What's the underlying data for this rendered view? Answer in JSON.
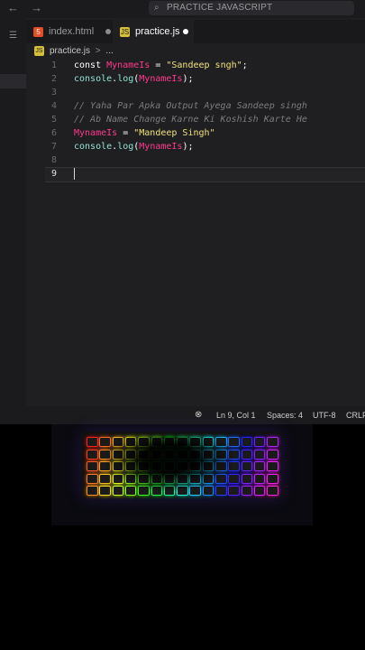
{
  "titlebar": {
    "search_text": "PRACTICE JAVASCRIPT",
    "back_icon": "arrow-left-icon",
    "forward_icon": "arrow-right-icon"
  },
  "tabs": [
    {
      "label": "index.html",
      "icon": "html5-icon",
      "icon_text": "5",
      "icon_color": "#e44d26",
      "modified": true
    },
    {
      "label": "practice.js",
      "icon": "js-icon",
      "icon_text": "JS",
      "icon_color": "#d6c03a",
      "modified": true,
      "active": true
    }
  ],
  "breadcrumb": {
    "file": "practice.js",
    "separator": ">",
    "rest": "..."
  },
  "editor": {
    "lines": [
      {
        "n": "1",
        "tokens": [
          [
            "kw",
            "const "
          ],
          [
            "var",
            "MynameIs"
          ],
          [
            "kw",
            " = "
          ],
          [
            "str",
            "\"Sandeep sngh\""
          ],
          [
            "kw",
            ";"
          ]
        ]
      },
      {
        "n": "2",
        "tokens": [
          [
            "fn",
            "console"
          ],
          [
            "kw",
            "."
          ],
          [
            "fn",
            "log"
          ],
          [
            "kw",
            "("
          ],
          [
            "var",
            "MynameIs"
          ],
          [
            "kw",
            ");"
          ]
        ]
      },
      {
        "n": "3",
        "tokens": []
      },
      {
        "n": "4",
        "tokens": [
          [
            "cmt",
            "// Yaha Par Apka Output Ayega Sandeep singh"
          ]
        ]
      },
      {
        "n": "5",
        "tokens": [
          [
            "cmt",
            "// Ab Name Change Karne Ki Koshish Karte He"
          ]
        ]
      },
      {
        "n": "6",
        "tokens": [
          [
            "var",
            "MynameIs"
          ],
          [
            "kw",
            " = "
          ],
          [
            "str",
            "\"Mandeep Singh\""
          ]
        ]
      },
      {
        "n": "7",
        "tokens": [
          [
            "fn",
            "console"
          ],
          [
            "kw",
            "."
          ],
          [
            "fn",
            "log"
          ],
          [
            "kw",
            "("
          ],
          [
            "var",
            "MynameIs"
          ],
          [
            "kw",
            ");"
          ]
        ]
      },
      {
        "n": "8",
        "tokens": []
      },
      {
        "n": "9",
        "tokens": []
      }
    ],
    "current_line": "9"
  },
  "statusbar": {
    "position": "Ln 9, Col 1",
    "spaces": "Spaces: 4",
    "encoding": "UTF-8",
    "eol": "CRLF"
  },
  "colors": {
    "keyword": "#ffffff",
    "variable": "#ff3a8e",
    "string": "#f0e27a",
    "function": "#8fe0d0",
    "comment": "#7c7c7c"
  }
}
